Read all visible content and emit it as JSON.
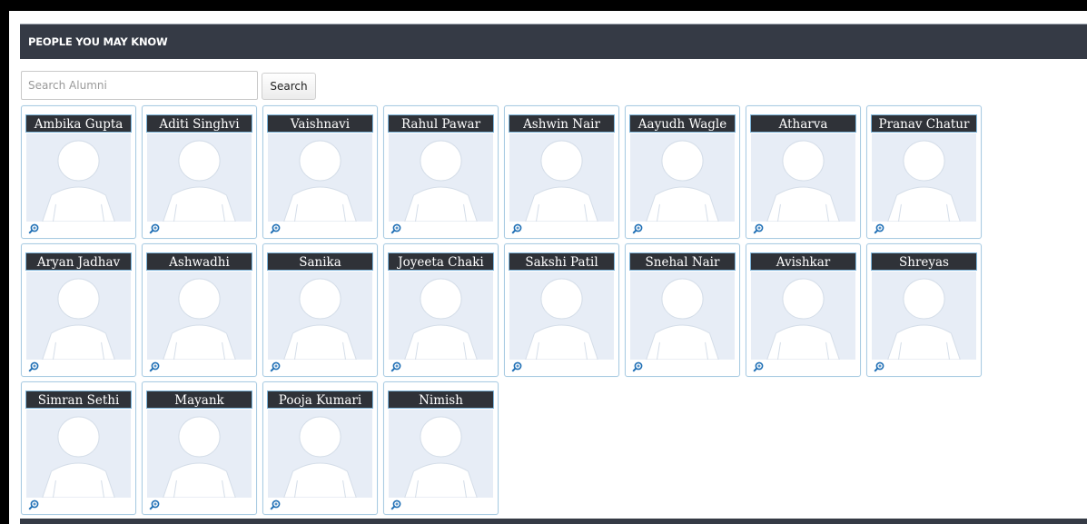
{
  "section": {
    "title": "PEOPLE YOU MAY KNOW"
  },
  "search": {
    "placeholder": "Search Alumni",
    "value": "",
    "button_label": "Search"
  },
  "people": [
    {
      "name": "Ambika Gupta"
    },
    {
      "name": "Aditi Singhvi"
    },
    {
      "name": "Vaishnavi"
    },
    {
      "name": "Rahul Pawar"
    },
    {
      "name": "Ashwin Nair"
    },
    {
      "name": "Aayudh Wagle"
    },
    {
      "name": "Atharva"
    },
    {
      "name": "Pranav Chatur"
    },
    {
      "name": "Aryan Jadhav"
    },
    {
      "name": "Ashwadhi"
    },
    {
      "name": "Sanika"
    },
    {
      "name": "Joyeeta Chaki"
    },
    {
      "name": "Sakshi Patil"
    },
    {
      "name": "Snehal Nair"
    },
    {
      "name": "Avishkar"
    },
    {
      "name": "Shreyas"
    },
    {
      "name": "Simran Sethi"
    },
    {
      "name": "Mayank"
    },
    {
      "name": "Pooja Kumari"
    },
    {
      "name": "Nimish"
    }
  ],
  "icons": {
    "avatar": "default-avatar-icon",
    "zoom": "zoom-icon"
  },
  "colors": {
    "header_bg": "#353a45",
    "header_text": "#ffffff",
    "card_border": "#a9cbe2",
    "name_label_bg": "#2f3238",
    "avatar_bg": "#e7edf6",
    "zoom_icon": "#1f6fb5"
  }
}
